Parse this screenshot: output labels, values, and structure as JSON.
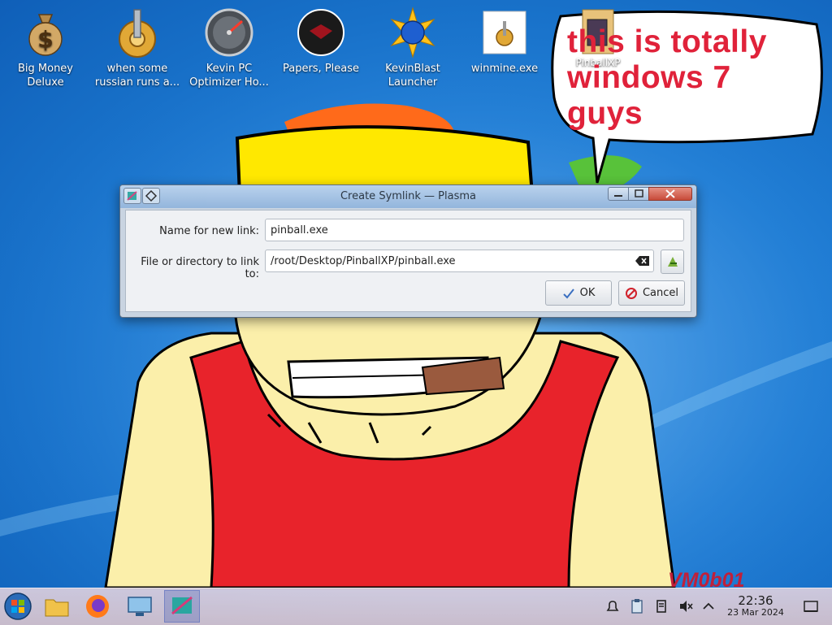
{
  "desktop": {
    "icons": [
      {
        "label": "Big Money Deluxe"
      },
      {
        "label": "when some russian runs a..."
      },
      {
        "label": "Kevin PC Optimizer Ho..."
      },
      {
        "label": "Papers, Please"
      },
      {
        "label": "KevinBlast Launcher"
      },
      {
        "label": "winmine.exe"
      }
    ],
    "folder": {
      "label": "PinballXP"
    },
    "bubble_text": "this is totally windows 7 guys",
    "watermark": "VM0b01"
  },
  "dialog": {
    "title": "Create Symlink — Plasma",
    "name_label": "Name for new link:",
    "name_value": "pinball.exe",
    "target_label": "File or directory to link to:",
    "target_value": "/root/Desktop/PinballXP/pinball.exe",
    "ok_label": "OK",
    "cancel_label": "Cancel"
  },
  "taskbar": {
    "clock_time": "22:36",
    "clock_date": "23 Mar 2024"
  },
  "colors": {
    "bubble_text": "#e0223a",
    "wallpaper_blue": "#1f7fd6",
    "shirt_red": "#e8232b",
    "skin": "#fbefaa",
    "hat_yellow": "#ffe800"
  }
}
